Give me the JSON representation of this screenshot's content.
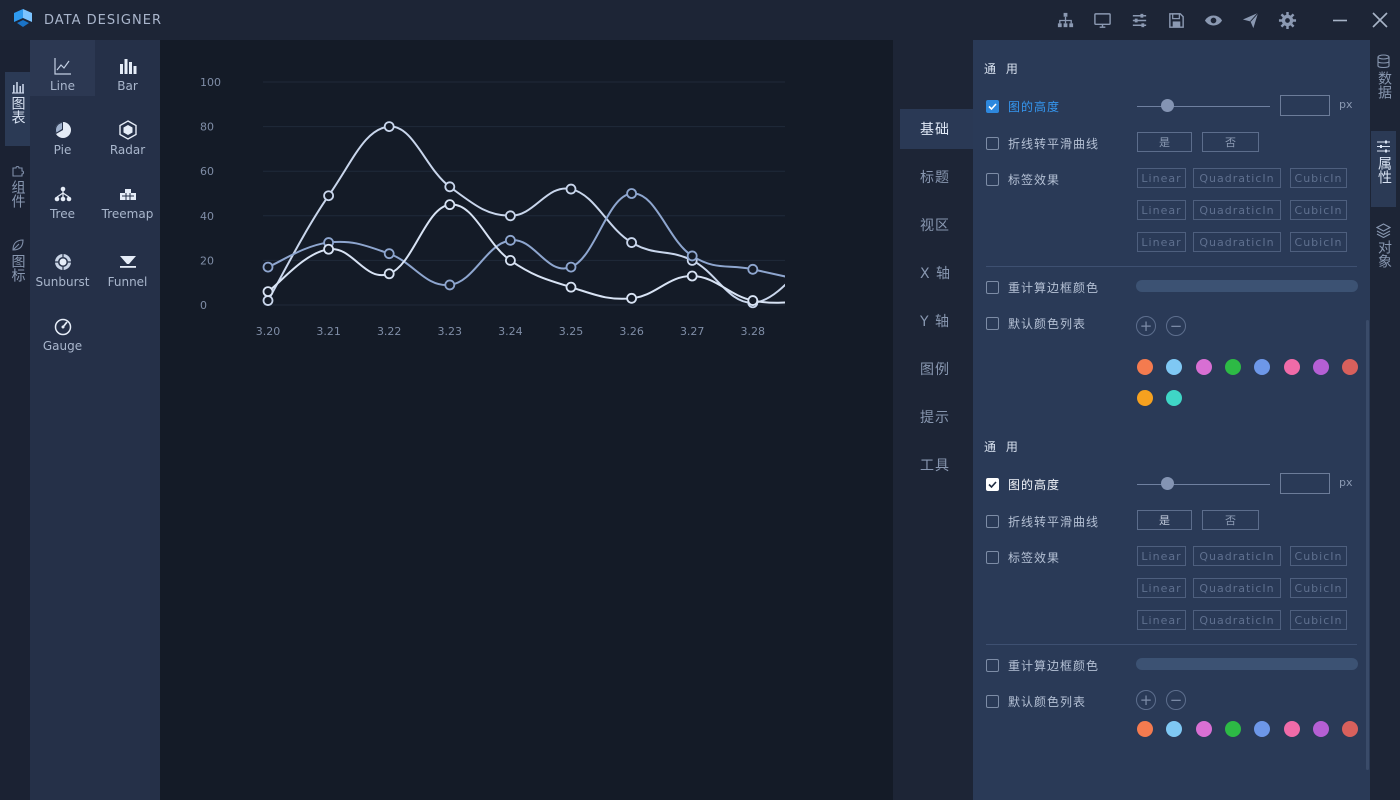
{
  "app": {
    "title": "DATA DESIGNER"
  },
  "toolbar": {
    "icons": [
      "hierarchy-icon",
      "monitor-icon",
      "sliders-icon",
      "save-icon",
      "eye-icon",
      "send-icon",
      "gear-icon"
    ]
  },
  "window_controls": [
    "minimize-icon",
    "close-icon"
  ],
  "left_rail": {
    "items": [
      {
        "label": "图表",
        "icon": "bar-chart-icon",
        "active": true
      },
      {
        "label": "组件",
        "icon": "puzzle-icon",
        "active": false
      },
      {
        "label": "图标",
        "icon": "leaf-icon",
        "active": false
      }
    ]
  },
  "chart_types": {
    "items": [
      {
        "label": "Line",
        "icon": "line-chart-icon",
        "active": true
      },
      {
        "label": "Bar",
        "icon": "bar-chart-icon",
        "active": false
      },
      {
        "label": "Pie",
        "icon": "pie-chart-icon",
        "active": false
      },
      {
        "label": "Radar",
        "icon": "radar-chart-icon",
        "active": false
      },
      {
        "label": "Tree",
        "icon": "tree-chart-icon",
        "active": false
      },
      {
        "label": "Treemap",
        "icon": "treemap-icon",
        "active": false
      },
      {
        "label": "Sunburst",
        "icon": "sunburst-icon",
        "active": false
      },
      {
        "label": "Funnel",
        "icon": "funnel-icon",
        "active": false
      },
      {
        "label": "Gauge",
        "icon": "gauge-icon",
        "active": false
      }
    ]
  },
  "chart_data": {
    "type": "line",
    "categories": [
      "3.20",
      "3.21",
      "3.22",
      "3.23",
      "3.24",
      "3.25",
      "3.26",
      "3.27",
      "3.28"
    ],
    "yticks": [
      "0",
      "20",
      "40",
      "60",
      "80",
      "100"
    ],
    "ylim": [
      0,
      100
    ],
    "smooth": true,
    "grid": true,
    "series": [
      {
        "values": [
          2,
          49,
          80,
          53,
          40,
          52,
          28,
          20,
          1,
          22
        ],
        "color": "#c9d6ec"
      },
      {
        "values": [
          17,
          28,
          23,
          9,
          29,
          17,
          50,
          22,
          16,
          10
        ],
        "color": "#8ea6cf"
      },
      {
        "values": [
          6,
          25,
          14,
          45,
          20,
          8,
          3,
          13,
          2,
          2
        ],
        "color": "#d8e3f4"
      }
    ]
  },
  "prop_tabs": {
    "items": [
      {
        "label": "基础",
        "active": true
      },
      {
        "label": "标题",
        "active": false
      },
      {
        "label": "视区",
        "active": false
      },
      {
        "label": "X 轴",
        "active": false
      },
      {
        "label": "Y 轴",
        "active": false
      },
      {
        "label": "图例",
        "active": false
      },
      {
        "label": "提示",
        "active": false
      },
      {
        "label": "工具",
        "active": false
      }
    ]
  },
  "panel": {
    "sections": [
      {
        "title": "通 用",
        "height_label": "图的高度",
        "height_checked": true,
        "height_value": "",
        "height_unit": "px",
        "smooth_label": "折线转平滑曲线",
        "yes_label": "是",
        "no_label": "否",
        "label_effect": "标签效果",
        "easings": [
          "Linear",
          "QuadraticIn",
          "CubicIn"
        ],
        "border_color_label": "重计算边框颜色",
        "color_list_label": "默认颜色列表",
        "add_symbol": "+",
        "remove_symbol": "−",
        "colors": [
          "#f47b4f",
          "#7fc8f4",
          "#d86fd3",
          "#2dba45",
          "#6d97e8",
          "#f06ba8",
          "#b55fd4",
          "#d8605c",
          "#f6a11f",
          "#3fd6c6"
        ]
      },
      {
        "title": "通 用",
        "height_label": "图的高度",
        "height_checked": true,
        "height_value": "",
        "height_unit": "px",
        "smooth_label": "折线转平滑曲线",
        "yes_label": "是",
        "no_label": "否",
        "label_effect": "标签效果",
        "easings": [
          "Linear",
          "QuadraticIn",
          "CubicIn"
        ],
        "border_color_label": "重计算边框颜色",
        "color_list_label": "默认颜色列表",
        "add_symbol": "+",
        "remove_symbol": "−",
        "colors": [
          "#f47b4f",
          "#7fc8f4",
          "#d86fd3",
          "#2dba45",
          "#6d97e8",
          "#f06ba8",
          "#b55fd4",
          "#d8605c"
        ]
      }
    ]
  },
  "right_rail": {
    "items": [
      {
        "label": "数据",
        "icon": "database-icon",
        "active": false
      },
      {
        "label": "属性",
        "icon": "sliders-icon",
        "active": true
      },
      {
        "label": "对象",
        "icon": "layers-icon",
        "active": false
      }
    ]
  }
}
